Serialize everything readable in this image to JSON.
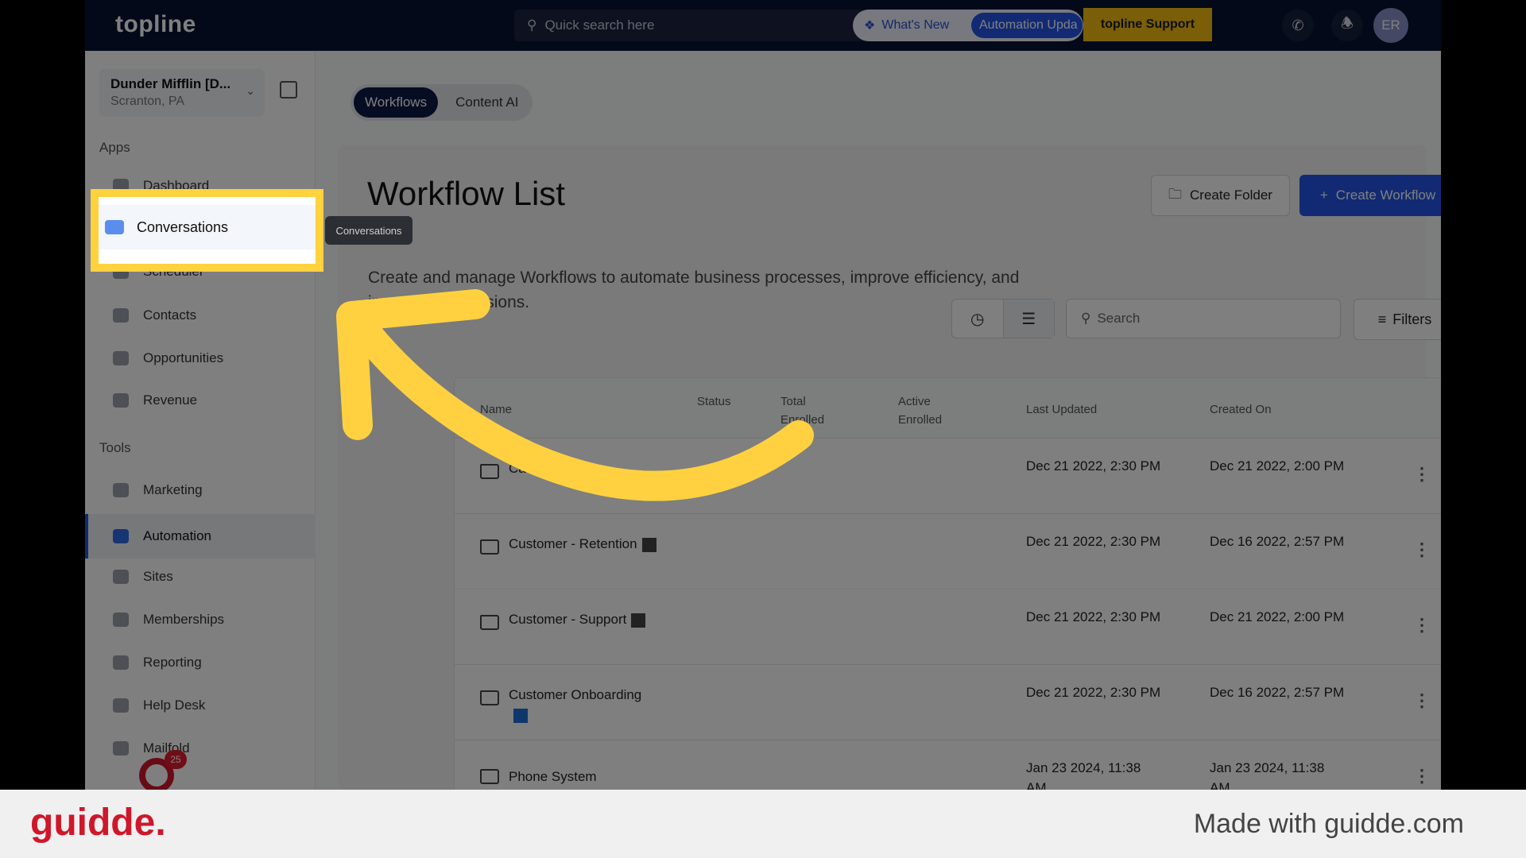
{
  "topbar": {
    "logo": "topline",
    "search_placeholder": "Quick search here",
    "whats_new": "What's New",
    "automation_updates": "Automation Upda",
    "support": "topline Support",
    "avatar": "ER"
  },
  "sidebar": {
    "account_name": "Dunder Mifflin [D...",
    "account_location": "Scranton, PA",
    "apps_label": "Apps",
    "tools_label": "Tools",
    "apps": [
      {
        "label": "Dashboard"
      },
      {
        "label": "Conversations"
      },
      {
        "label": "Scheduler"
      },
      {
        "label": "Contacts"
      },
      {
        "label": "Opportunities"
      },
      {
        "label": "Revenue"
      }
    ],
    "tools": [
      {
        "label": "Marketing"
      },
      {
        "label": "Automation"
      },
      {
        "label": "Sites"
      },
      {
        "label": "Memberships"
      },
      {
        "label": "Reporting"
      },
      {
        "label": "Help Desk"
      },
      {
        "label": "Mailfold"
      }
    ],
    "badge_count": "25",
    "tooltip": "Conversations"
  },
  "main": {
    "tabs": [
      {
        "label": "Workflows"
      },
      {
        "label": "Content AI"
      }
    ],
    "title": "Workflow List",
    "description": "Create and manage Workflows to automate business processes, improve efficiency, and increase conversions.",
    "create_folder": "Create Folder",
    "create_workflow": "Create Workflow",
    "search_placeholder": "Search",
    "filters": "Filters",
    "columns": [
      "Name",
      "Status",
      "Total Enrolled",
      "Active Enrolled",
      "Last Updated",
      "Created On"
    ],
    "rows": [
      {
        "name": "Calendar",
        "emoji": "calendar",
        "last_updated": "Dec 21 2022, 2:30 PM",
        "created_on": "Dec 21 2022, 2:00 PM"
      },
      {
        "name": "Customer - Retention",
        "emoji": "handshake",
        "last_updated": "Dec 21 2022, 2:30 PM",
        "created_on": "Dec 16 2022, 2:57 PM"
      },
      {
        "name": "Customer - Support",
        "emoji": "person-raising-hand",
        "last_updated": "Dec 21 2022, 2:30 PM",
        "created_on": "Dec 21 2022, 2:00 PM"
      },
      {
        "name": "Customer Onboarding",
        "emoji": "new-button",
        "last_updated": "Dec 21 2022, 2:30 PM",
        "created_on": "Dec 16 2022, 2:57 PM"
      },
      {
        "name": "Phone System",
        "emoji": "",
        "last_updated": "Jan 23 2024, 11:38 AM",
        "created_on": "Jan 23 2024, 11:38 AM"
      }
    ]
  },
  "footer": {
    "brand": "guidde.",
    "made_with": "Made with guidde.com"
  },
  "colors": {
    "highlight": "#ffd23e",
    "arrow": "#ffd140",
    "primary": "#2455e6",
    "brand_red": "#d0172a"
  }
}
